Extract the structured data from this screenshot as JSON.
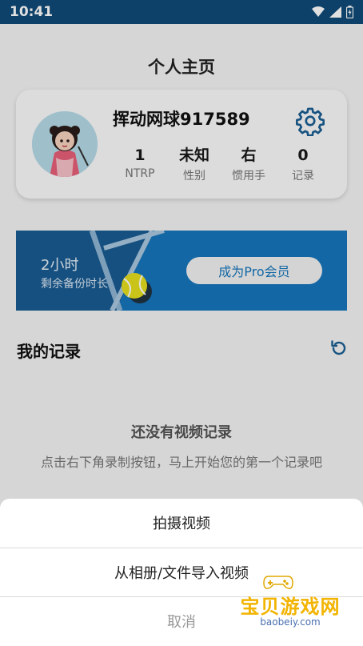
{
  "status_bar": {
    "time": "10:41"
  },
  "header": {
    "title": "个人主页"
  },
  "profile": {
    "username": "挥动网球917589",
    "stats": [
      {
        "value": "1",
        "label": "NTRP"
      },
      {
        "value": "未知",
        "label": "性别"
      },
      {
        "value": "右",
        "label": "惯用手"
      },
      {
        "value": "0",
        "label": "记录"
      }
    ]
  },
  "banner": {
    "backup_time": "2小时",
    "backup_label": "剩余备份时长",
    "pro_button": "成为Pro会员"
  },
  "records": {
    "title": "我的记录",
    "empty_title": "还没有视频记录",
    "empty_subtitle": "点击右下角录制按钮，马上开始您的第一个记录吧"
  },
  "action_sheet": {
    "items": [
      "拍摄视频",
      "从相册/文件导入视频"
    ],
    "cancel": "取消"
  },
  "watermark": {
    "text": "宝贝游戏网",
    "url": "baobeiy.com"
  },
  "colors": {
    "status_bar": "#0f4b78",
    "accent_blue": "#1676bc"
  }
}
